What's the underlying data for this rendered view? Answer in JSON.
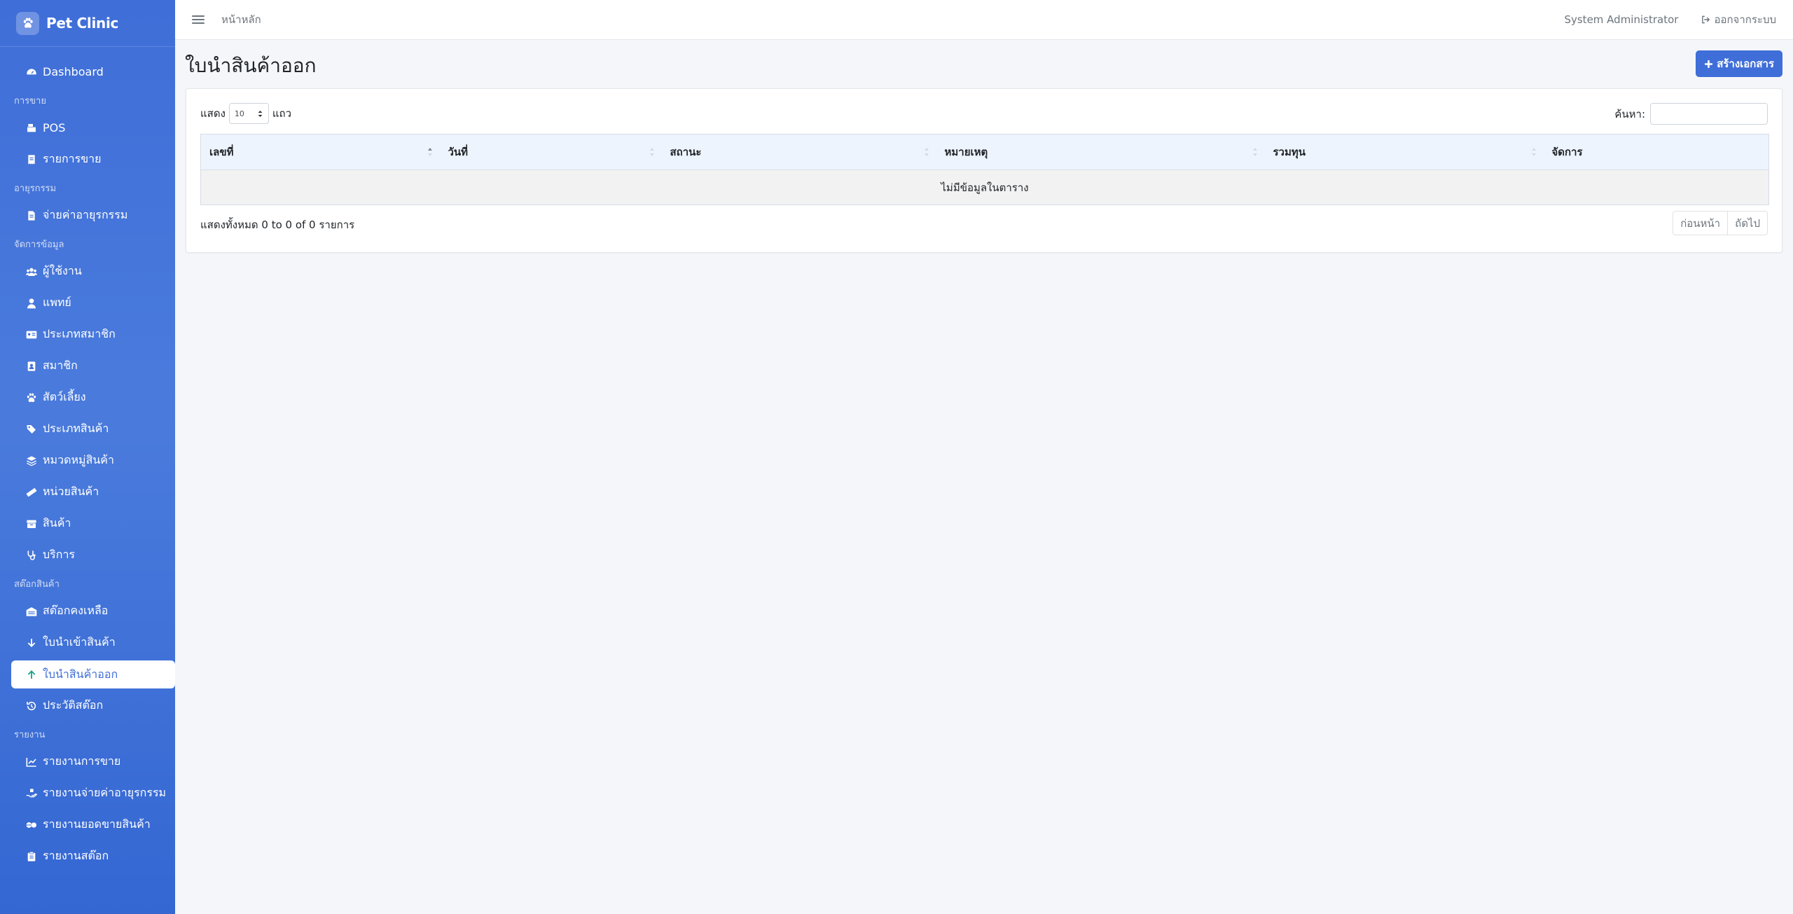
{
  "brand": {
    "name": "Pet Clinic"
  },
  "topbar": {
    "breadcrumb": "หน้าหลัก",
    "user": "System Administrator",
    "logout": "ออกจากระบบ"
  },
  "sidebar": {
    "items": [
      {
        "type": "item",
        "label": "Dashboard",
        "icon": "dashboard-icon"
      },
      {
        "type": "header",
        "label": "การขาย"
      },
      {
        "type": "item",
        "label": "POS",
        "icon": "cash-register-icon"
      },
      {
        "type": "item",
        "label": "รายการขาย",
        "icon": "receipt-icon"
      },
      {
        "type": "header",
        "label": "อายุรกรรม"
      },
      {
        "type": "item",
        "label": "จ่ายค่าอายุรกรรม",
        "icon": "file-invoice-icon"
      },
      {
        "type": "header",
        "label": "จัดการข้อมูล"
      },
      {
        "type": "item",
        "label": "ผู้ใช้งาน",
        "icon": "users-icon"
      },
      {
        "type": "item",
        "label": "แพทย์",
        "icon": "doctor-icon"
      },
      {
        "type": "item",
        "label": "ประเภทสมาชิก",
        "icon": "id-card-icon"
      },
      {
        "type": "item",
        "label": "สมาชิก",
        "icon": "member-icon"
      },
      {
        "type": "item",
        "label": "สัตว์เลี้ยง",
        "icon": "paw-icon"
      },
      {
        "type": "item",
        "label": "ประเภทสินค้า",
        "icon": "tags-icon"
      },
      {
        "type": "item",
        "label": "หมวดหมู่สินค้า",
        "icon": "layers-icon"
      },
      {
        "type": "item",
        "label": "หน่วยสินค้า",
        "icon": "ruler-icon"
      },
      {
        "type": "item",
        "label": "สินค้า",
        "icon": "box-icon"
      },
      {
        "type": "item",
        "label": "บริการ",
        "icon": "stethoscope-icon"
      },
      {
        "type": "header",
        "label": "สต๊อกสินค้า"
      },
      {
        "type": "item",
        "label": "สต๊อกคงเหลือ",
        "icon": "warehouse-icon"
      },
      {
        "type": "item",
        "label": "ใบนำเข้าสินค้า",
        "icon": "arrow-down-icon"
      },
      {
        "type": "item",
        "label": "ใบนำสินค้าออก",
        "icon": "arrow-up-icon",
        "active": true
      },
      {
        "type": "item",
        "label": "ประวัติสต๊อก",
        "icon": "history-icon"
      },
      {
        "type": "header",
        "label": "รายงาน"
      },
      {
        "type": "item",
        "label": "รายงานการขาย",
        "icon": "chart-line-icon"
      },
      {
        "type": "item",
        "label": "รายงานจ่ายค่าอายุรกรรม",
        "icon": "hand-holding-icon"
      },
      {
        "type": "item",
        "label": "รายงานยอดขายสินค้า",
        "icon": "pills-icon"
      },
      {
        "type": "item",
        "label": "รายงานสต๊อก",
        "icon": "clipboard-icon"
      }
    ]
  },
  "main": {
    "title": "ใบนำสินค้าออก",
    "create_button": "สร้างเอกสาร",
    "length": {
      "prefix": "แสดง",
      "value": "10",
      "suffix": "แถว"
    },
    "search_label": "ค้นหา:",
    "search_value": "",
    "columns": [
      "เลขที่",
      "วันที่",
      "สถานะ",
      "หมายเหตุ",
      "รวมทุน",
      "จัดการ"
    ],
    "empty_message": "ไม่มีข้อมูลในตาราง",
    "info": "แสดงทั้งหมด 0 to 0 of 0 รายการ",
    "pagination": {
      "prev": "ก่อนหน้า",
      "next": "ถัดไป"
    }
  }
}
